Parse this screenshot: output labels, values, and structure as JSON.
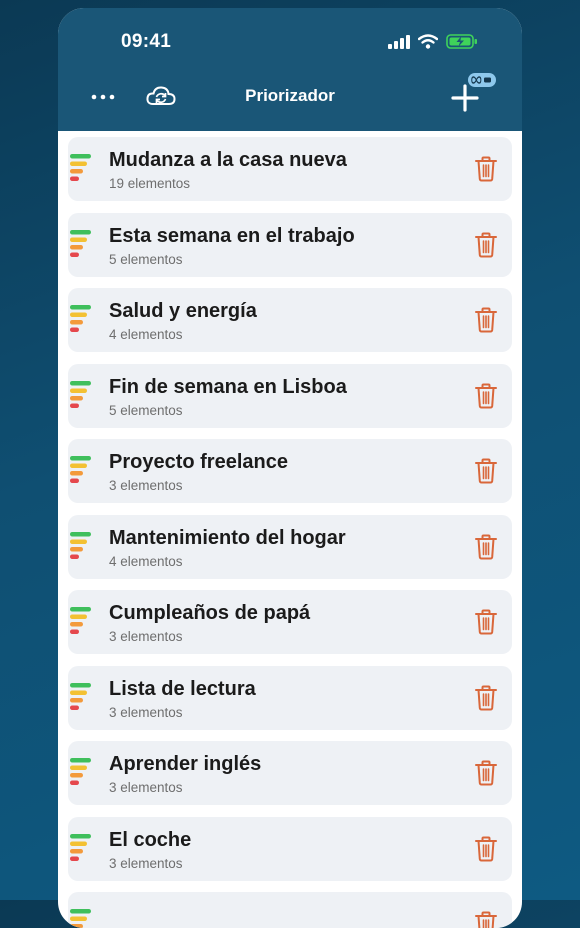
{
  "status": {
    "time": "09:41"
  },
  "nav": {
    "title": "Priorizador"
  },
  "lists": [
    {
      "title": "Mudanza a la casa nueva",
      "subtitle": "19 elementos"
    },
    {
      "title": "Esta semana en el trabajo",
      "subtitle": "5 elementos"
    },
    {
      "title": "Salud y energía",
      "subtitle": "4 elementos"
    },
    {
      "title": "Fin de semana en Lisboa",
      "subtitle": "5 elementos"
    },
    {
      "title": "Proyecto freelance",
      "subtitle": "3 elementos"
    },
    {
      "title": "Mantenimiento del hogar",
      "subtitle": "4 elementos"
    },
    {
      "title": "Cumpleaños de papá",
      "subtitle": "3 elementos"
    },
    {
      "title": "Lista de lectura",
      "subtitle": "3 elementos"
    },
    {
      "title": "Aprender inglés",
      "subtitle": "3 elementos"
    },
    {
      "title": "El coche",
      "subtitle": "3 elementos"
    },
    {
      "title": "",
      "subtitle": ""
    }
  ],
  "icons": {
    "more": "more-horizontal-icon",
    "sync": "cloud-sync-icon",
    "add": "plus-icon",
    "pro": "infinity-badge-icon",
    "priority": "priority-bars-icon",
    "delete": "trash-icon"
  },
  "colors": {
    "header": "#1a5677",
    "row_background": "#eef1f5",
    "trash": "#d9673a",
    "priority_green": "#3fbf5c",
    "priority_yellow": "#f3c133",
    "priority_orange": "#f39a3b",
    "priority_red": "#e5484d"
  }
}
